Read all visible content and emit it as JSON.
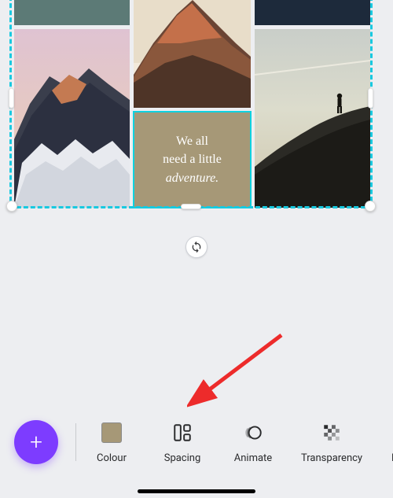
{
  "collage": {
    "quote_line1": "We all",
    "quote_line2": "need a little",
    "quote_line3": "adventure."
  },
  "toolbar": {
    "fab_label": "+",
    "items": [
      {
        "id": "colour",
        "label": "Colour"
      },
      {
        "id": "spacing",
        "label": "Spacing"
      },
      {
        "id": "animate",
        "label": "Animate"
      },
      {
        "id": "transparency",
        "label": "Transparency"
      },
      {
        "id": "position",
        "label": "P"
      }
    ]
  },
  "colors": {
    "accent": "#7d3cff",
    "selection": "#18c9e0",
    "swatch": "#a69877"
  }
}
